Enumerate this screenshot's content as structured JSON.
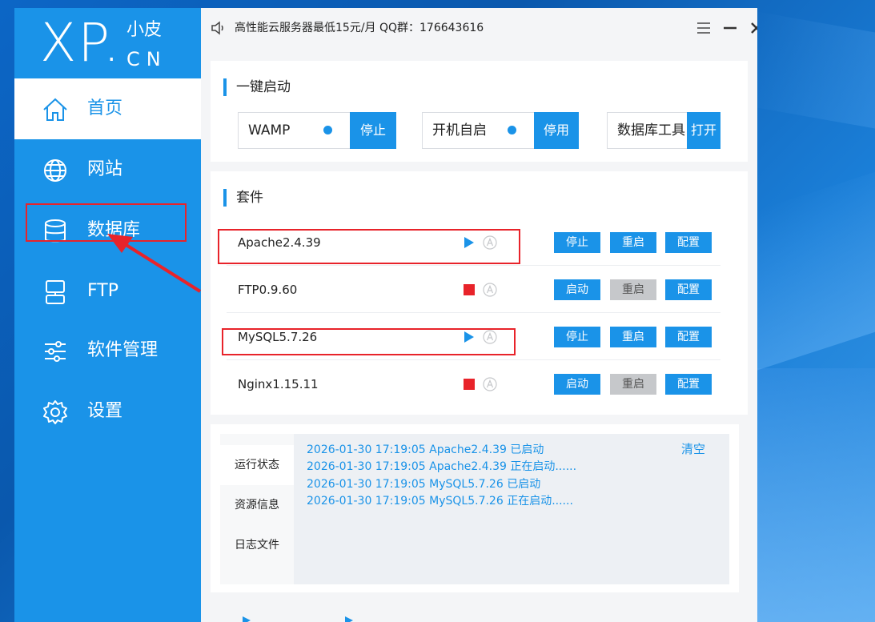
{
  "app": {
    "logo_main": "XP.",
    "logo_small": "小皮",
    "logo_cn": "CN",
    "notice": "高性能云服务器最低15元/月  QQ群：176643616"
  },
  "sidebar": {
    "items": [
      {
        "label": "首页",
        "icon": "home-icon",
        "active": true
      },
      {
        "label": "网站",
        "icon": "globe-icon",
        "active": false
      },
      {
        "label": "数据库",
        "icon": "database-icon",
        "active": false
      },
      {
        "label": "FTP",
        "icon": "ftp-icon",
        "active": false
      },
      {
        "label": "软件管理",
        "icon": "sliders-icon",
        "active": false
      },
      {
        "label": "设置",
        "icon": "gear-icon",
        "active": false
      }
    ]
  },
  "quick_start": {
    "title": "一键启动",
    "items": [
      {
        "label": "WAMP",
        "button": "停止",
        "dot": true
      },
      {
        "label": "开机自启",
        "button": "停用",
        "dot": true
      },
      {
        "label": "数据库工具",
        "button": "打开",
        "dot": false
      }
    ]
  },
  "suite": {
    "title": "套件",
    "rows": [
      {
        "name": "Apache2.4.39",
        "status": "running",
        "btn1": "停止",
        "btn2": "重启",
        "btn3": "配置",
        "btn2_disabled": false
      },
      {
        "name": "FTP0.9.60",
        "status": "stopped",
        "btn1": "启动",
        "btn2": "重启",
        "btn3": "配置",
        "btn2_disabled": true
      },
      {
        "name": "MySQL5.7.26",
        "status": "running",
        "btn1": "停止",
        "btn2": "重启",
        "btn3": "配置",
        "btn2_disabled": false
      },
      {
        "name": "Nginx1.15.11",
        "status": "stopped",
        "btn1": "启动",
        "btn2": "重启",
        "btn3": "配置",
        "btn2_disabled": true
      }
    ]
  },
  "log": {
    "tabs": [
      "运行状态",
      "资源信息",
      "日志文件"
    ],
    "clear_label": "清空",
    "lines": [
      "2026-01-30 17:19:05 Apache2.4.39 已启动",
      "2026-01-30 17:19:05 Apache2.4.39 正在启动......",
      "2026-01-30 17:19:05 MySQL5.7.26 已启动",
      "2026-01-30 17:19:05 MySQL5.7.26 正在启动......"
    ]
  },
  "colors": {
    "accent": "#1a93e8",
    "stopped": "#e8232a",
    "annotation": "#e8232a"
  }
}
